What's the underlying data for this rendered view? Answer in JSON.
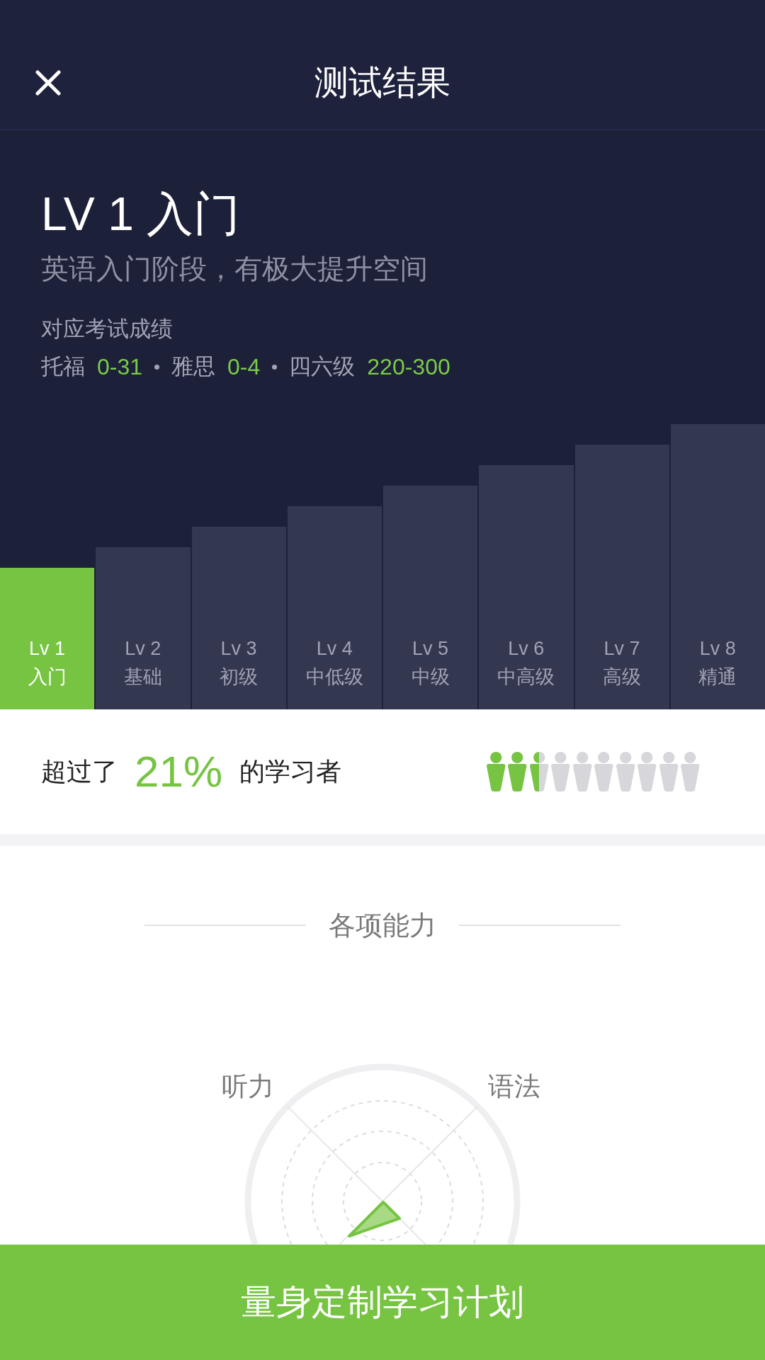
{
  "header": {
    "title": "测试结果"
  },
  "result": {
    "level_title": "LV 1 入门",
    "description": "英语入门阶段，有极大提升空间",
    "exam_heading": "对应考试成绩",
    "exam_scores": [
      {
        "name": "托福",
        "score": "0-31"
      },
      {
        "name": "雅思",
        "score": "0-4"
      },
      {
        "name": "四六级",
        "score": "220-300"
      }
    ]
  },
  "levels": [
    {
      "label": "Lv 1",
      "name": "入门",
      "selected": true
    },
    {
      "label": "Lv 2",
      "name": "基础",
      "selected": false
    },
    {
      "label": "Lv 3",
      "name": "初级",
      "selected": false
    },
    {
      "label": "Lv 4",
      "name": "中低级",
      "selected": false
    },
    {
      "label": "Lv 5",
      "name": "中级",
      "selected": false
    },
    {
      "label": "Lv 6",
      "name": "中高级",
      "selected": false
    },
    {
      "label": "Lv 7",
      "name": "高级",
      "selected": false
    },
    {
      "label": "Lv 8",
      "name": "精通",
      "selected": false
    }
  ],
  "percentile": {
    "prefix": "超过了",
    "value": "21%",
    "suffix": "的学习者",
    "level": 0.25
  },
  "abilities": {
    "title": "各项能力",
    "axes": [
      {
        "label": "听力"
      },
      {
        "label": "语法"
      }
    ]
  },
  "action_button": {
    "label": "量身定制学习计划"
  }
}
